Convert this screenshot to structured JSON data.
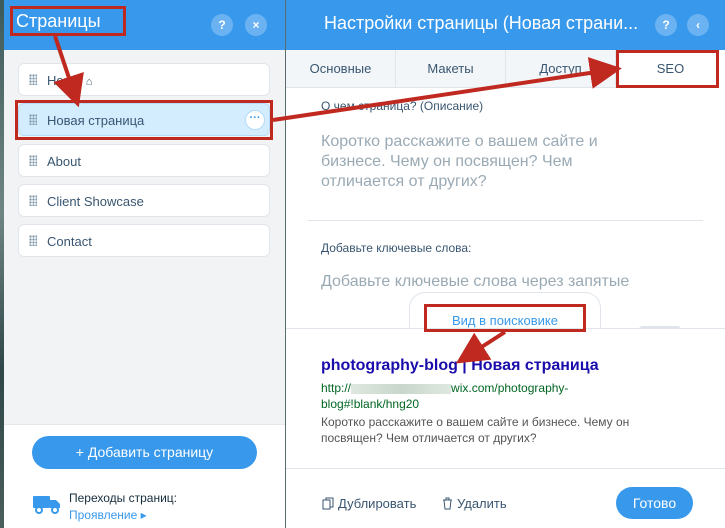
{
  "pages_panel": {
    "title": "Страницы",
    "help_label": "?",
    "close_label": "×",
    "items": [
      {
        "label": "Home",
        "home": true
      },
      {
        "label": "Новая страница",
        "selected": true,
        "more": "···"
      },
      {
        "label": "About"
      },
      {
        "label": "Client Showcase"
      },
      {
        "label": "Contact"
      }
    ],
    "add_page_label": "+ Добавить страницу",
    "transitions_label": "Переходы страниц:",
    "transitions_value": "Проявление ▸"
  },
  "settings_panel": {
    "title": "Настройки страницы (Новая страни...",
    "help_label": "?",
    "back_label": "‹",
    "tabs": [
      "Основные",
      "Макеты",
      "Доступ",
      "SEO"
    ],
    "active_tab": "SEO",
    "description_label": "О чем страница? (Описание)",
    "description_placeholder": "Коротко расскажите о вашем сайте и бизнесе. Чему он посвящен? Чем отличается от других?",
    "keywords_label": "Добавьте ключевые слова:",
    "keywords_placeholder": "Добавьте ключевые слова через запятые",
    "preview_tab": "Вид в поисковике",
    "serp_title": "photography-blog | Новая страница",
    "serp_url_prefix": "http://",
    "serp_url_rest": "wix.com/photography-blog#!blank/hng20",
    "serp_description": "Коротко расскажите о вашем сайте и бизнесе. Чему он посвящен? Чем отличается от других?",
    "duplicate_label": "Дублировать",
    "delete_label": "Удалить",
    "done_label": "Готово"
  },
  "colors": {
    "accent": "#3899ec",
    "annotation": "#c0291f",
    "serp_title": "#1a0dab",
    "serp_url": "#006621"
  }
}
